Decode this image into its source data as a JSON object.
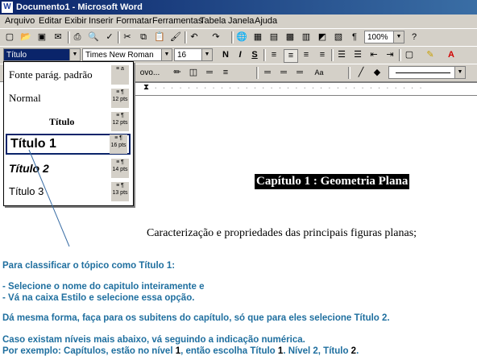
{
  "window": {
    "title": "Documento1 - Microsoft Word",
    "icon": "word-icon"
  },
  "menu": [
    "Arquivo",
    "Editar",
    "Exibir",
    "Inserir",
    "Formatar",
    "Ferramentas",
    "Tabela",
    "Janela",
    "Ajuda"
  ],
  "toolbar": {
    "zoom": "100%",
    "style_value": "Título",
    "font_value": "Times New Roman",
    "size_value": "16",
    "bold": "N",
    "italic": "I",
    "underline": "S",
    "format_tools_partial": "ovo..."
  },
  "style_dropdown": {
    "items": [
      {
        "name": "Fonte parág. padrão",
        "icons": "≡ a",
        "size": ""
      },
      {
        "name": "Normal",
        "icons": "≡ ¶",
        "size": "12 pts"
      },
      {
        "name": "Título",
        "icons": "≡ ¶",
        "size": "12 pts"
      },
      {
        "name": "Título 1",
        "icons": "≡ ¶",
        "size": "16 pts"
      },
      {
        "name": "Título 2",
        "icons": "≡ ¶",
        "size": "14 pts"
      },
      {
        "name": "Título 3",
        "icons": "≡ ¶",
        "size": "13 pts"
      }
    ]
  },
  "document": {
    "chapter_heading": "Capítulo 1 : Geometria Plana",
    "subtitle": "Caracterização e propriedades das principais figuras planas;",
    "instructions": [
      "Para classificar o tópico como Título 1:",
      "- Selecione o nome do capitulo inteiramente e",
      "- Vá na caixa Estilo e selecione essa opção.",
      "Dá mesma forma, faça para os subitens do capítulo, só que para eles selecione Título 2.",
      "Caso existam níveis mais abaixo, vá seguindo a indicação numérica."
    ],
    "example": {
      "prefix": "Por exemplo: Capítulos, estão no nível ",
      "level1": "1",
      "mid1": ", então escolha Título ",
      "title1": "1",
      "mid2": ". Nível 2, Título ",
      "title2": "2",
      "suffix": "."
    }
  },
  "colors": {
    "title_bar": "#0a246a",
    "instruction_text": "#1f6f9f",
    "pointer_line": "#3a6ea5"
  }
}
